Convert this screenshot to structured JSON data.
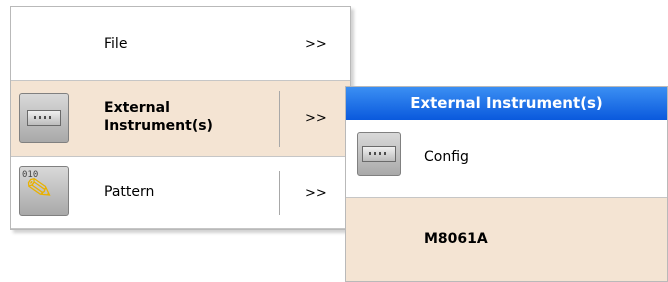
{
  "menu": {
    "items": [
      {
        "label": "File",
        "arrow": ">>",
        "icon": "none"
      },
      {
        "label": "External\nInstrument(s)",
        "arrow": ">>",
        "icon": "instrument-icon"
      },
      {
        "label": "Pattern",
        "arrow": ">>",
        "icon": "pencil-pattern-icon",
        "icon_text": "010"
      }
    ]
  },
  "submenu": {
    "title": "External Instrument(s)",
    "items": [
      {
        "label": "Config",
        "icon": "instrument-icon"
      },
      {
        "label": "M8061A"
      }
    ]
  },
  "colors": {
    "hover_background": "#f4e4d3",
    "submenu_header_top": "#3b8ff3",
    "submenu_header_bottom": "#0a59dd"
  }
}
